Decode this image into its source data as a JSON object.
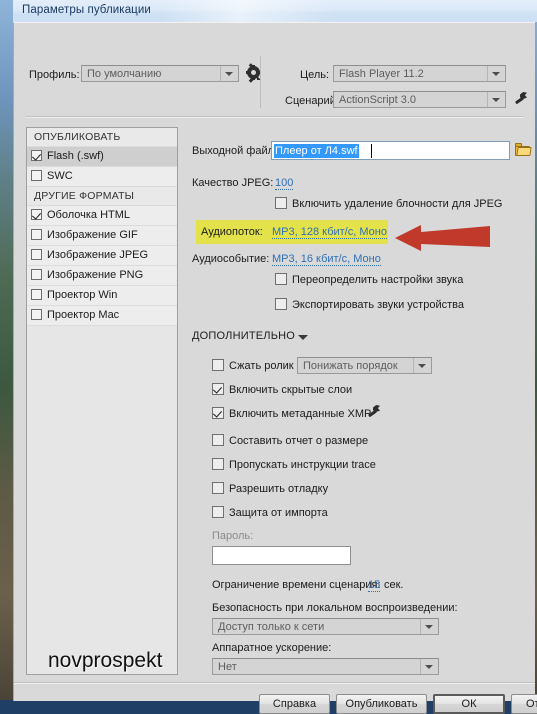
{
  "window": {
    "title": "Параметры публикации"
  },
  "toolbar": {
    "profile_label": "Профиль:",
    "profile_value": "По умолчанию",
    "gear_icon": "gear-icon",
    "target_label": "Цель:",
    "target_value": "Flash Player 11.2",
    "script_label": "Сценарий:",
    "script_value": "ActionScript 3.0",
    "wrench_icon": "wrench-icon"
  },
  "sidebar": {
    "groups": [
      {
        "title": "ОПУБЛИКОВАТЬ",
        "items": [
          {
            "label": "Flash (.swf)",
            "checked": true,
            "selected": true
          },
          {
            "label": "SWC",
            "checked": false,
            "selected": false
          }
        ]
      },
      {
        "title": "ДРУГИЕ ФОРМАТЫ",
        "items": [
          {
            "label": "Оболочка HTML",
            "checked": true,
            "selected": false
          },
          {
            "label": "Изображение GIF",
            "checked": false,
            "selected": false
          },
          {
            "label": "Изображение JPEG",
            "checked": false,
            "selected": false
          },
          {
            "label": "Изображение PNG",
            "checked": false,
            "selected": false
          },
          {
            "label": "Проектор Win",
            "checked": false,
            "selected": false
          },
          {
            "label": "Проектор Mac",
            "checked": false,
            "selected": false
          }
        ]
      }
    ],
    "watermark": "novprospekt"
  },
  "main": {
    "output_file_label": "Выходной файл:",
    "output_file_value": "Плеер от Л4.swf",
    "browse_icon": "folder-icon",
    "jpeg_quality_label": "Качество JPEG:",
    "jpeg_quality_value": "100",
    "deblock_label": "Включить удаление блочности для JPEG",
    "deblock_checked": false,
    "audio_stream_label": "Аудиопоток:",
    "audio_stream_value": "MP3, 128 кбит/с, Моно",
    "audio_event_label": "Аудиособытие:",
    "audio_event_value": "MP3, 16 кбит/с, Моно",
    "override_sound_label": "Переопределить настройки звука",
    "override_sound_checked": false,
    "export_device_sounds_label": "Экспортировать звуки устройства",
    "export_device_sounds_checked": false,
    "advanced_label": "ДОПОЛНИТЕЛЬНО",
    "advanced_caret_icon": "chevron-down-icon",
    "compress_label": "Сжать ролик",
    "compress_checked": false,
    "compress_value": "Понижать порядок",
    "hidden_layers_label": "Включить скрытые слои",
    "hidden_layers_checked": true,
    "xmp_label": "Включить метаданные XMP",
    "xmp_checked": true,
    "xmp_icon": "wrench-icon",
    "size_report_label": "Составить отчет о размере",
    "size_report_checked": false,
    "omit_trace_label": "Пропускать инструкции trace",
    "omit_trace_checked": false,
    "allow_debug_label": "Разрешить отладку",
    "allow_debug_checked": false,
    "protect_import_label": "Защита от импорта",
    "protect_import_checked": false,
    "password_label": "Пароль:",
    "password_value": "",
    "script_time_label": "Ограничение времени сценария:",
    "script_time_value": "15",
    "script_time_units": "сек.",
    "local_security_label": "Безопасность при локальном воспроизведении:",
    "local_security_value": "Доступ только к сети",
    "hw_accel_label": "Аппаратное ускорение:",
    "hw_accel_value": "Нет"
  },
  "annotation": {
    "arrow_icon": "red-arrow-left",
    "arrow_color": "#c0392b",
    "highlight_color": "#e4e24a"
  },
  "footer": {
    "help": "Справка",
    "publish": "Опубликовать",
    "ok": "ОК",
    "cancel": "Отмена"
  }
}
